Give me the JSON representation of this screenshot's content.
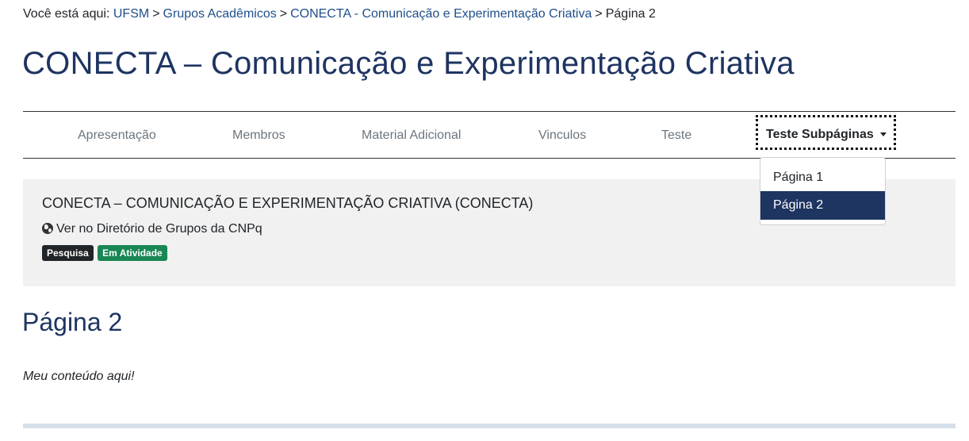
{
  "breadcrumb": {
    "prefix": "Você está aqui:",
    "items": [
      "UFSM",
      "Grupos Acadêmicos",
      "CONECTA - Comunicação e Experimentação Criativa"
    ],
    "current": "Página 2",
    "separator": ">"
  },
  "page_title": "CONECTA – Comunicação e Experimentação Criativa",
  "tabs": [
    {
      "label": "Apresentação"
    },
    {
      "label": "Membros"
    },
    {
      "label": "Material Adicional"
    },
    {
      "label": "Vinculos"
    },
    {
      "label": "Teste"
    },
    {
      "label": "Teste Subpáginas"
    }
  ],
  "dropdown": {
    "items": [
      {
        "label": "Página 1"
      },
      {
        "label": "Página 2"
      }
    ],
    "selected": "Página 2"
  },
  "group": {
    "name": "CONECTA – COMUNICAÇÃO E EXPERIMENTAÇÃO CRIATIVA (CONECTA)",
    "cnpq_link": "Ver no Diretório de Grupos da CNPq",
    "badges": [
      {
        "label": "Pesquisa",
        "color": "#212529"
      },
      {
        "label": "Em Atividade",
        "color": "#198754"
      }
    ]
  },
  "section_title": "Página 2",
  "content": "Meu conteúdo aqui!",
  "colors": {
    "title": "#1e3461",
    "link": "#1f4f8a",
    "selected_bg": "#1e3461"
  }
}
